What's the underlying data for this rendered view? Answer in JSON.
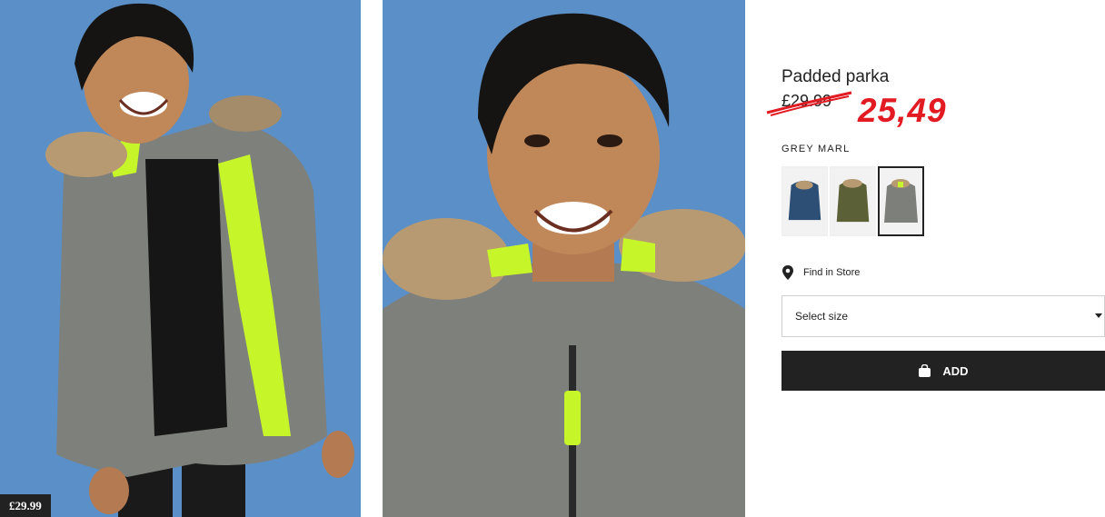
{
  "product": {
    "title": "Padded parka",
    "old_price": "£29.99",
    "new_price": "25,49",
    "color_name": "GREY MARL",
    "image_price_tag": "£29.99"
  },
  "swatches": [
    {
      "color": "#2d4f76",
      "name": "dark-blue"
    },
    {
      "color": "#5c6036",
      "name": "khaki-green"
    },
    {
      "color": "#7d7f7a",
      "name": "grey-marl",
      "selected": true
    }
  ],
  "find_in_store": {
    "label": "Find in Store",
    "icon": "location-pin-icon"
  },
  "size_select": {
    "label": "Select size",
    "icon": "caret-down-icon"
  },
  "add_button": {
    "label": "ADD",
    "icon": "shopping-bag-icon"
  },
  "colors": {
    "photo_background": "#5b8fc7",
    "jacket": "#7e807b",
    "neon": "#c6f52a",
    "price_red": "#e21a22",
    "button_black": "#222222"
  }
}
